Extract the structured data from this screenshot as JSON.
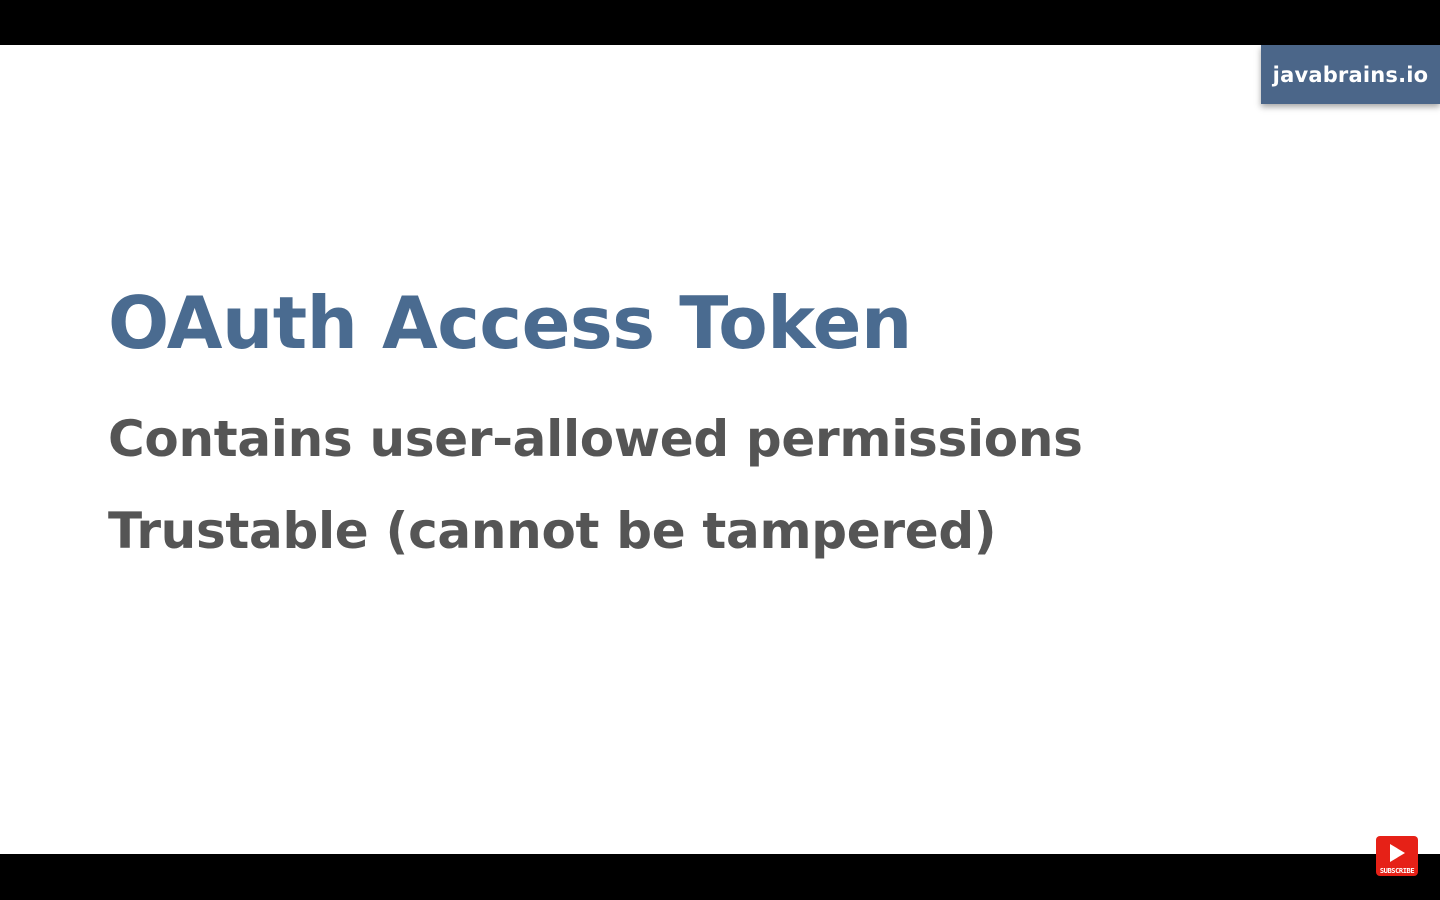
{
  "slide": {
    "brand": "javabrains.io",
    "title": "OAuth Access Token",
    "bullets": [
      "Contains user-allowed permissions",
      "Trustable (cannot be tampered)"
    ]
  },
  "overlay": {
    "subscribe_label": "SUBSCRIBE",
    "subscribe_icon": "play-icon"
  },
  "colors": {
    "title": "#4a6b90",
    "body_text": "#555555",
    "brand_badge": "#4b6689",
    "subscribe_button": "#e62117",
    "letterbox": "#000000",
    "slide_background": "#ffffff"
  }
}
